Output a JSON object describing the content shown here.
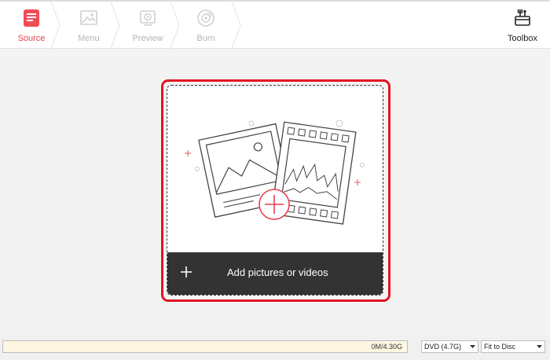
{
  "steps": [
    {
      "label": "Source",
      "icon": "source-icon",
      "active": true
    },
    {
      "label": "Menu",
      "icon": "menu-icon",
      "active": false
    },
    {
      "label": "Preview",
      "icon": "preview-icon",
      "active": false
    },
    {
      "label": "Burn",
      "icon": "burn-icon",
      "active": false
    }
  ],
  "toolbox": {
    "label": "Toolbox",
    "icon": "toolbox-icon"
  },
  "dropzone": {
    "label": "Add pictures or videos",
    "icon": "plus-icon"
  },
  "status": {
    "capacity": "0M/4.30G",
    "disc_type": "DVD (4.7G)",
    "fit_mode": "Fit to Disc"
  },
  "colors": {
    "accent": "#e8414f",
    "highlight": "#e4141f",
    "addbar": "#333333"
  }
}
